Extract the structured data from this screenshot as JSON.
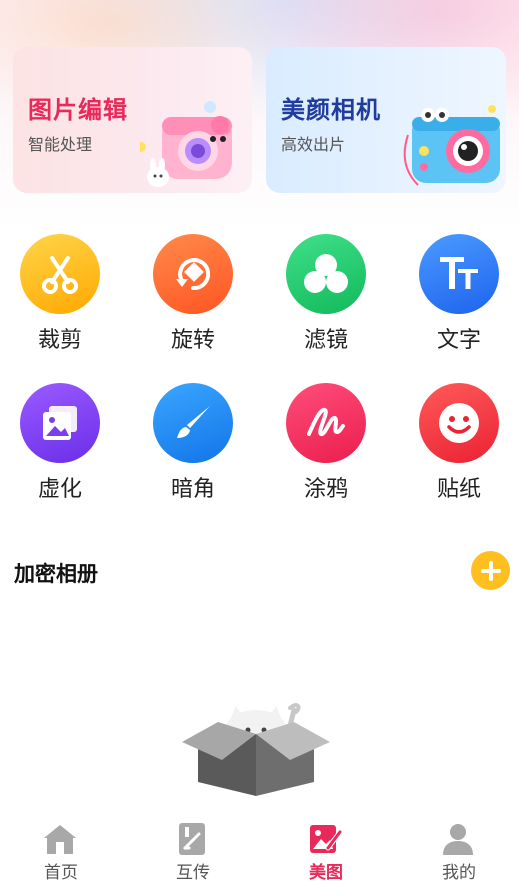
{
  "banners": [
    {
      "title": "图片编辑",
      "subtitle": "智能处理"
    },
    {
      "title": "美颜相机",
      "subtitle": "高效出片"
    }
  ],
  "tools": [
    {
      "label": "裁剪",
      "icon": "scissors-icon",
      "color": "#ffb300"
    },
    {
      "label": "旋转",
      "icon": "rotate-icon",
      "color": "#ff6a2a"
    },
    {
      "label": "滤镜",
      "icon": "filter-clover-icon",
      "color": "#22c76b"
    },
    {
      "label": "文字",
      "icon": "text-icon",
      "color": "#2f7cf6"
    },
    {
      "label": "虚化",
      "icon": "blur-image-icon",
      "color": "#7b3df0"
    },
    {
      "label": "暗角",
      "icon": "brush-icon",
      "color": "#1e8ef3"
    },
    {
      "label": "涂鸦",
      "icon": "doodle-icon",
      "color": "#f2305e"
    },
    {
      "label": "贴纸",
      "icon": "sticker-smile-icon",
      "color": "#f2394a"
    }
  ],
  "album": {
    "title": "加密相册",
    "add_icon": "plus-icon",
    "add_color": "#ffbf1f"
  },
  "tabbar": {
    "items": [
      {
        "label": "首页",
        "icon": "home-icon"
      },
      {
        "label": "互传",
        "icon": "transfer-icon"
      },
      {
        "label": "美图",
        "icon": "image-edit-icon",
        "active": true
      },
      {
        "label": "我的",
        "icon": "user-icon"
      }
    ],
    "active_color": "#e8295a",
    "inactive_color": "#a8a8a8"
  }
}
